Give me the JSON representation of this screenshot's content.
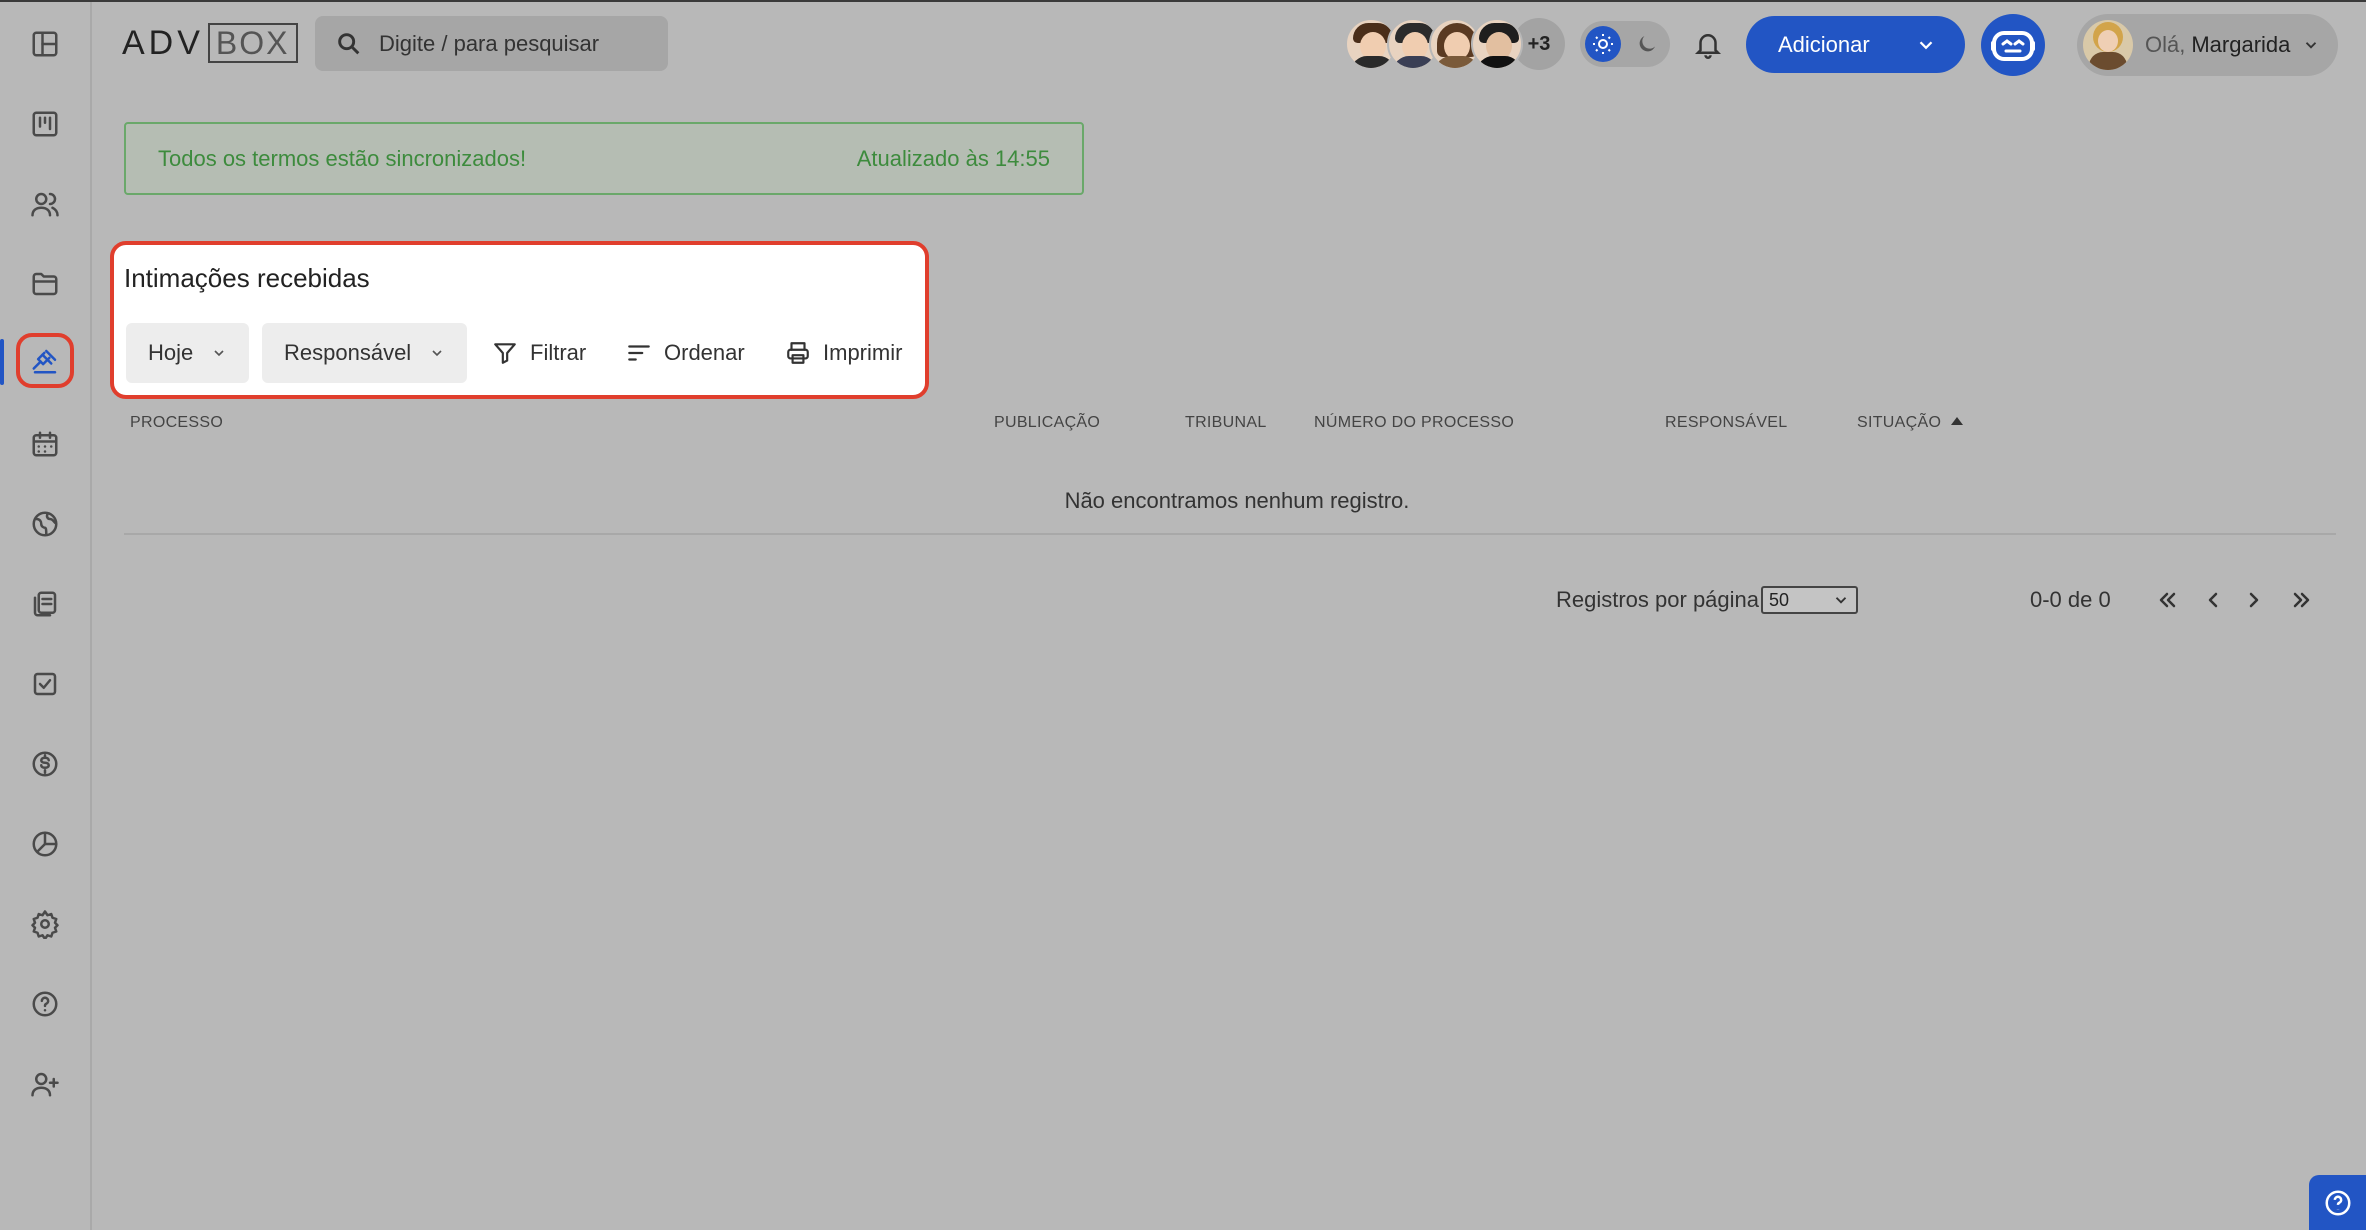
{
  "header": {
    "logo_left": "ADV",
    "logo_box": "BOX",
    "search_placeholder": "Digite / para pesquisar",
    "team_more": "+3",
    "add_button": "Adicionar",
    "greeting": "Olá,",
    "user_name": "Margarida"
  },
  "sidebar": {
    "items": [
      {
        "icon": "dashboard-icon"
      },
      {
        "icon": "kanban-icon"
      },
      {
        "icon": "users-icon"
      },
      {
        "icon": "folder-icon"
      },
      {
        "icon": "gavel-icon",
        "active": true
      },
      {
        "icon": "calendar-icon"
      },
      {
        "icon": "globe-icon"
      },
      {
        "icon": "documents-icon"
      },
      {
        "icon": "tasks-icon"
      },
      {
        "icon": "finance-icon"
      },
      {
        "icon": "reports-icon"
      },
      {
        "icon": "settings-icon"
      },
      {
        "icon": "help-icon"
      },
      {
        "icon": "add-user-icon"
      }
    ]
  },
  "sync": {
    "message": "Todos os termos estão sincronizados!",
    "updated": "Atualizado às 14:55"
  },
  "panel": {
    "title": "Intimações recebidas",
    "period_select": "Hoje",
    "responsible_select": "Responsável",
    "filter": "Filtrar",
    "order": "Ordenar",
    "print": "Imprimir"
  },
  "table": {
    "columns": [
      "PROCESSO",
      "PUBLICAÇÃO",
      "TRIBUNAL",
      "NÚMERO DO PROCESSO",
      "RESPONSÁVEL",
      "SITUAÇÃO"
    ],
    "sorted_column": "SITUAÇÃO",
    "sort_direction": "asc",
    "empty_message": "Não encontramos nenhum registro."
  },
  "pagination": {
    "per_page_label": "Registros por página",
    "per_page_value": "50",
    "range": "0-0 de 0"
  },
  "colors": {
    "primary": "#2255c4",
    "highlight": "#e03e2d",
    "success": "#3d8b3d"
  }
}
